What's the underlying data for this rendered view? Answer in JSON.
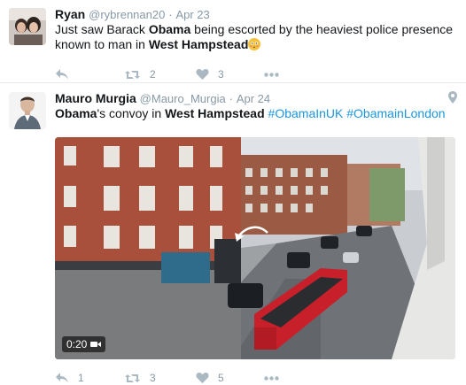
{
  "tweets": [
    {
      "fullname": "Ryan",
      "username": "@rybrennan20",
      "separator": "·",
      "time": "Apr 23",
      "text_parts": [
        {
          "t": "Just saw Barack ",
          "bold": false
        },
        {
          "t": "Obama",
          "bold": true
        },
        {
          "t": " being escorted by the heaviest police presence known to man in ",
          "bold": false
        },
        {
          "t": "West Hampstead",
          "bold": true
        }
      ],
      "reply_count": "",
      "retweet_count": "2",
      "like_count": "3"
    },
    {
      "fullname": "Mauro Murgia",
      "username": "@Mauro_Murgia",
      "separator": "·",
      "time": "Apr 24",
      "text_parts": [
        {
          "t": "Obama",
          "bold": true
        },
        {
          "t": "'s convoy in ",
          "bold": false
        },
        {
          "t": "West Hampstead",
          "bold": true
        },
        {
          "t": " ",
          "bold": false
        }
      ],
      "hashtags": [
        "#ObamaInUK",
        "#ObamainLondon"
      ],
      "video_duration": "0:20",
      "reply_count": "1",
      "retweet_count": "3",
      "like_count": "5"
    }
  ],
  "icons": {
    "reply": "reply-icon",
    "retweet": "retweet-icon",
    "like": "heart-icon",
    "more": "more-icon",
    "location": "location-pin-icon",
    "video": "video-camera-icon"
  },
  "colors": {
    "icon_gray": "#aab8c2",
    "link_blue": "#1b95e0",
    "meta_gray": "#8899a6",
    "text": "#14171a"
  }
}
